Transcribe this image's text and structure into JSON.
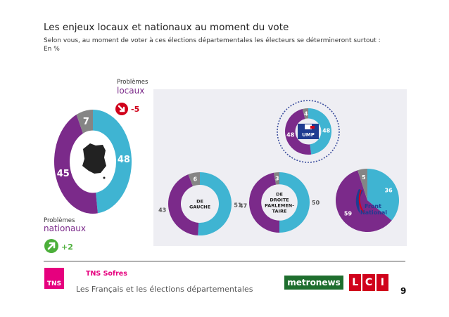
{
  "header": {
    "title": "Les enjeux locaux et nationaux au moment du vote",
    "subtitle": "Selon vous, au moment de voter à ces élections départementales les électeurs se détermineront surtout :",
    "unit": "En %"
  },
  "left_labels": {
    "top_small": "Problèmes",
    "top_big": "locaux",
    "top_change": "-5",
    "bottom_small": "Problèmes",
    "bottom_big": "nationaux",
    "bottom_change": "+2"
  },
  "colors": {
    "blue": "#3fb4d2",
    "purple": "#7b2a8a",
    "gray": "#858585",
    "red": "#d0021b",
    "green": "#4caf3a"
  },
  "chart_data": [
    {
      "type": "pie",
      "name": "Ensemble",
      "values": [
        48,
        45,
        7
      ],
      "labels": [
        "48",
        "45",
        "7"
      ]
    },
    {
      "type": "pie",
      "name": "UMP",
      "values": [
        48,
        48,
        4
      ],
      "labels": [
        "48",
        "48",
        "4"
      ],
      "badge": "UMP"
    },
    {
      "type": "pie",
      "name": "DE GAUCHE",
      "center_label": "DE\nGAUCHE",
      "values": [
        51,
        43,
        6
      ],
      "labels": [
        "51",
        "43",
        "6"
      ]
    },
    {
      "type": "pie",
      "name": "DE DROITE PARLEMENTAIRE",
      "center_label": "DE\nDROITE\nPARLEMEN-\nTAIRE",
      "values": [
        50,
        47,
        3
      ],
      "labels": [
        "50",
        "47",
        "3"
      ]
    },
    {
      "type": "pie",
      "name": "Front National",
      "values": [
        36,
        59,
        5
      ],
      "labels": [
        "36",
        "59",
        "5"
      ],
      "badge": "Front National"
    }
  ],
  "footer": {
    "brand_box": "TNS",
    "brand": "TNS Sofres",
    "text": "Les Français et les élections départementales",
    "metro": "metronews",
    "lci": [
      "L",
      "C",
      "I"
    ],
    "page": "9"
  }
}
